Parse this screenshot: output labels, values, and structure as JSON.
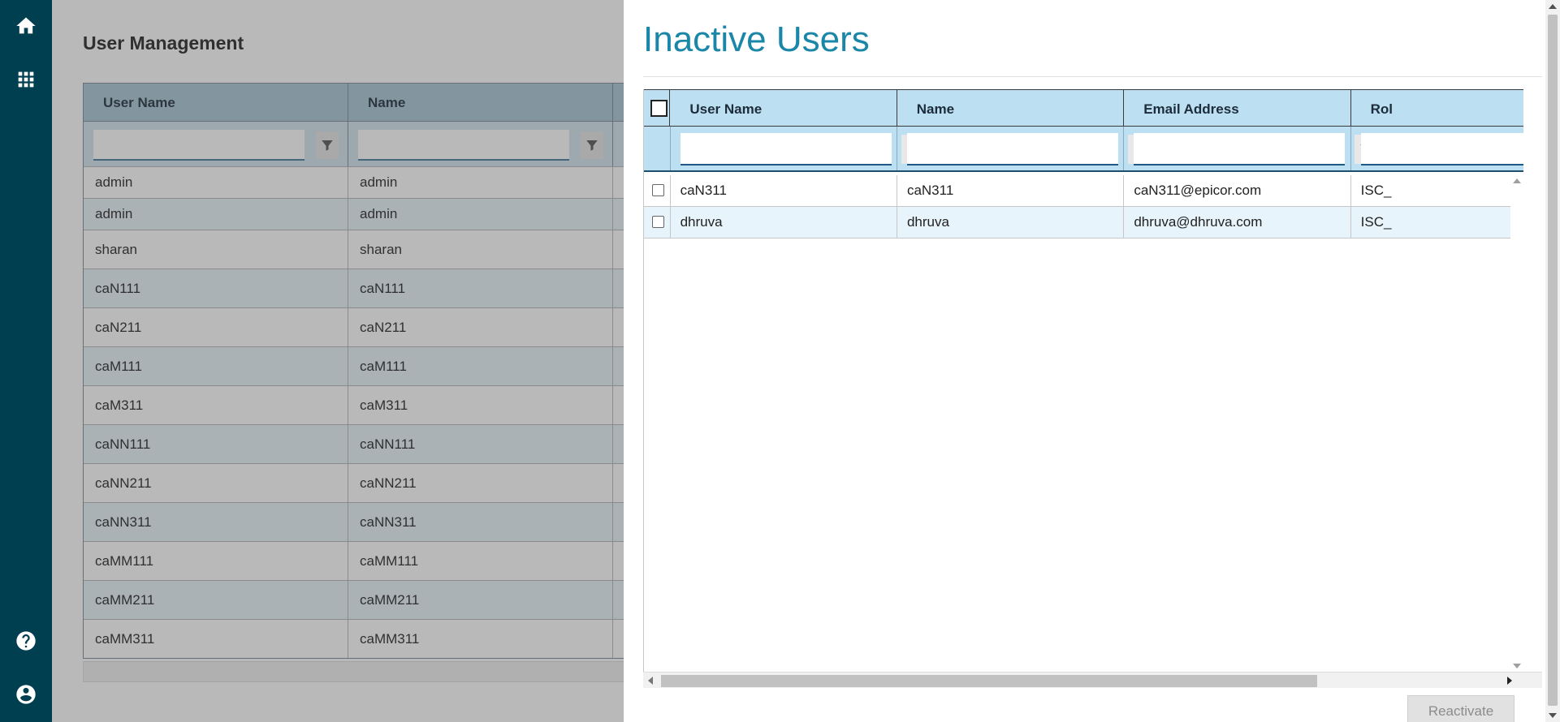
{
  "nav": {
    "top_icons": [
      "home-icon",
      "apps-grid-icon"
    ],
    "bottom_icons": [
      "help-icon",
      "account-icon"
    ]
  },
  "background_page": {
    "title": "User Management",
    "columns": [
      "User Name",
      "Name"
    ],
    "rows": [
      [
        "admin",
        "admin"
      ],
      [
        "admin",
        "admin"
      ],
      [
        "sharan",
        "sharan"
      ],
      [
        "caN111",
        "caN111"
      ],
      [
        "caN211",
        "caN211"
      ],
      [
        "caM111",
        "caM111"
      ],
      [
        "caM311",
        "caM311"
      ],
      [
        "caNN111",
        "caNN111"
      ],
      [
        "caNN211",
        "caNN211"
      ],
      [
        "caNN311",
        "caNN311"
      ],
      [
        "caMM111",
        "caMM111"
      ],
      [
        "caMM211",
        "caMM211"
      ],
      [
        "caMM311",
        "caMM311"
      ]
    ]
  },
  "dialog": {
    "title": "Inactive Users",
    "columns": [
      "User Name",
      "Name",
      "Email Address",
      "Rol"
    ],
    "rows": [
      [
        "caN311",
        "caN311",
        "caN311@epicor.com",
        "ISC_"
      ],
      [
        "dhruva",
        "dhruva",
        "dhruva@dhruva.com",
        "ISC_"
      ]
    ],
    "reactivate_label": "Reactivate"
  },
  "colors": {
    "nav_bg": "#003f50",
    "title_accent": "#1a86a8",
    "header_bg": "#bce0f2",
    "row_alt": "#e7f4fb"
  }
}
